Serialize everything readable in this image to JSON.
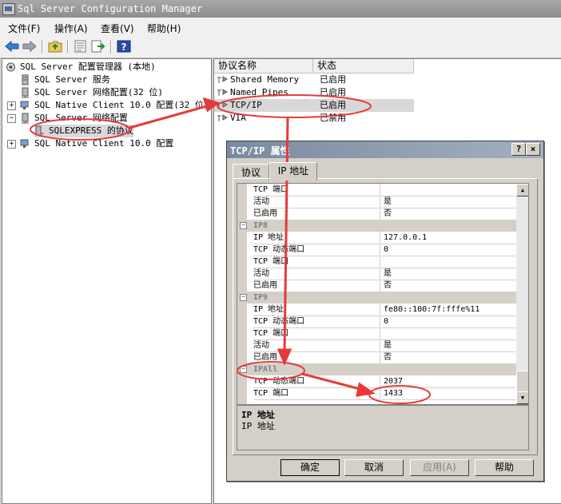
{
  "window": {
    "title": "Sql Server Configuration Manager"
  },
  "menu": {
    "items": [
      "文件(F)",
      "操作(A)",
      "查看(V)",
      "帮助(H)"
    ]
  },
  "toolbar": {
    "icons": [
      "back-arrow-icon",
      "forward-arrow-icon",
      "up-folder-icon",
      "properties-icon",
      "export-icon",
      "help-icon"
    ]
  },
  "tree": {
    "items": [
      {
        "label": "SQL Server 配置管理器 (本地)",
        "icon": "config-manager-icon"
      },
      {
        "label": "SQL Server 服务",
        "icon": "server-icon"
      },
      {
        "label": "SQL Server 网络配置(32 位)",
        "icon": "network-icon"
      },
      {
        "label": "SQL Native Client 10.0 配置(32 位)",
        "icon": "client-icon",
        "expander": "+"
      },
      {
        "label": "SQL Server 网络配置",
        "icon": "network-icon",
        "expander": "−"
      },
      {
        "label": "SQLEXPRESS 的协议",
        "icon": "protocol-icon"
      },
      {
        "label": "SQL Native Client 10.0 配置",
        "icon": "client-icon",
        "expander": "+"
      }
    ]
  },
  "list": {
    "columns": [
      "协议名称",
      "状态"
    ],
    "rows": [
      {
        "name": "Shared Memory",
        "status": "已启用"
      },
      {
        "name": "Named Pipes",
        "status": "已启用"
      },
      {
        "name": "TCP/IP",
        "status": "已启用"
      },
      {
        "name": "VIA",
        "status": "已禁用"
      }
    ]
  },
  "dialog": {
    "title": "TCP/IP 属性",
    "help_btn": "?",
    "close_btn": "×",
    "tabs": [
      "协议",
      "IP 地址"
    ],
    "grid_rows": [
      {
        "type": "kv",
        "k": "TCP 端口",
        "v": ""
      },
      {
        "type": "kv",
        "k": "活动",
        "v": "是"
      },
      {
        "type": "kv",
        "k": "已启用",
        "v": "否"
      },
      {
        "type": "section",
        "k": "IP8"
      },
      {
        "type": "kv",
        "k": "IP 地址",
        "v": "127.0.0.1"
      },
      {
        "type": "kv",
        "k": "TCP 动态端口",
        "v": "0"
      },
      {
        "type": "kv",
        "k": "TCP 端口",
        "v": ""
      },
      {
        "type": "kv",
        "k": "活动",
        "v": "是"
      },
      {
        "type": "kv",
        "k": "已启用",
        "v": "否"
      },
      {
        "type": "section",
        "k": "IP9"
      },
      {
        "type": "kv",
        "k": "IP 地址",
        "v": "fe80::100:7f:fffe%11"
      },
      {
        "type": "kv",
        "k": "TCP 动态端口",
        "v": "0"
      },
      {
        "type": "kv",
        "k": "TCP 端口",
        "v": ""
      },
      {
        "type": "kv",
        "k": "活动",
        "v": "是"
      },
      {
        "type": "kv",
        "k": "已启用",
        "v": "否"
      },
      {
        "type": "section",
        "k": "IPAll"
      },
      {
        "type": "kv",
        "k": "TCP 动态端口",
        "v": "2037"
      },
      {
        "type": "kv",
        "k": "TCP 端口",
        "v": "1433"
      }
    ],
    "desc_title": "IP 地址",
    "desc_text": "IP 地址",
    "buttons": {
      "ok": "确定",
      "cancel": "取消",
      "apply": "应用(A)",
      "help": "帮助"
    }
  },
  "colors": {
    "annotation": "#e8393a",
    "selection": "#d8d8d8"
  }
}
